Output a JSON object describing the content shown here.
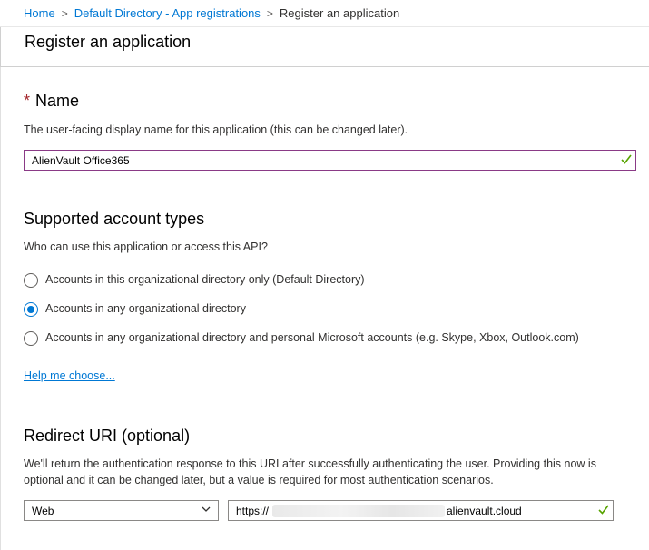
{
  "breadcrumb": {
    "home": "Home",
    "directory": "Default Directory - App registrations",
    "current": "Register an application",
    "separator": ">"
  },
  "page": {
    "title": "Register an application"
  },
  "name_section": {
    "required_marker": "*",
    "title": "Name",
    "description": "The user-facing display name for this application (this can be changed later).",
    "value": "AlienVault Office365",
    "valid_icon": "checkmark-icon"
  },
  "account_types": {
    "title": "Supported account types",
    "description": "Who can use this application or access this API?",
    "options": [
      {
        "label": "Accounts in this organizational directory only (Default Directory)",
        "selected": false
      },
      {
        "label": "Accounts in any organizational directory",
        "selected": true
      },
      {
        "label": "Accounts in any organizational directory and personal Microsoft accounts (e.g. Skype, Xbox, Outlook.com)",
        "selected": false
      }
    ],
    "help_link": "Help me choose..."
  },
  "redirect": {
    "title": "Redirect URI (optional)",
    "description": "We'll return the authentication response to this URI after successfully authenticating the user. Providing this now is optional and it can be changed later, but a value is required for most authentication scenarios.",
    "platform": "Web",
    "uri_prefix": "https://",
    "uri_suffix": "alienvault.cloud"
  },
  "colors": {
    "accent": "#0078d4",
    "required": "#a4262c",
    "valid": "#57a300"
  }
}
